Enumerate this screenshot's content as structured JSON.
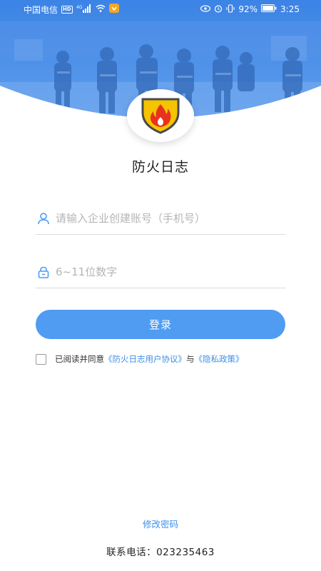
{
  "status_bar": {
    "carrier": "中国电信",
    "hd_badge": "HD",
    "network": "4G",
    "battery": "92%",
    "time": "3:25"
  },
  "app": {
    "title": "防火日志",
    "logo_icon": "fire-shield-icon"
  },
  "form": {
    "phone_placeholder": "请输入企业创建账号（手机号）",
    "phone_value": "",
    "phone_icon": "user-icon",
    "password_placeholder": "6~11位数字",
    "password_value": "",
    "password_icon": "lock-icon",
    "login_label": "登录"
  },
  "agreement": {
    "checked": false,
    "prefix": "已阅读并同意",
    "user_agreement": "《防火日志用户协议》",
    "joiner": "与",
    "privacy_policy": "《隐私政策》"
  },
  "footer": {
    "change_password": "修改密码",
    "contact_label": "联系电话：",
    "contact_phone": "023235463"
  },
  "colors": {
    "accent": "#4f9cf2",
    "link": "#3f8fe6",
    "hero_blue": "#3f86e6",
    "shield_yellow": "#f5c400",
    "flame_red": "#e8321f"
  }
}
